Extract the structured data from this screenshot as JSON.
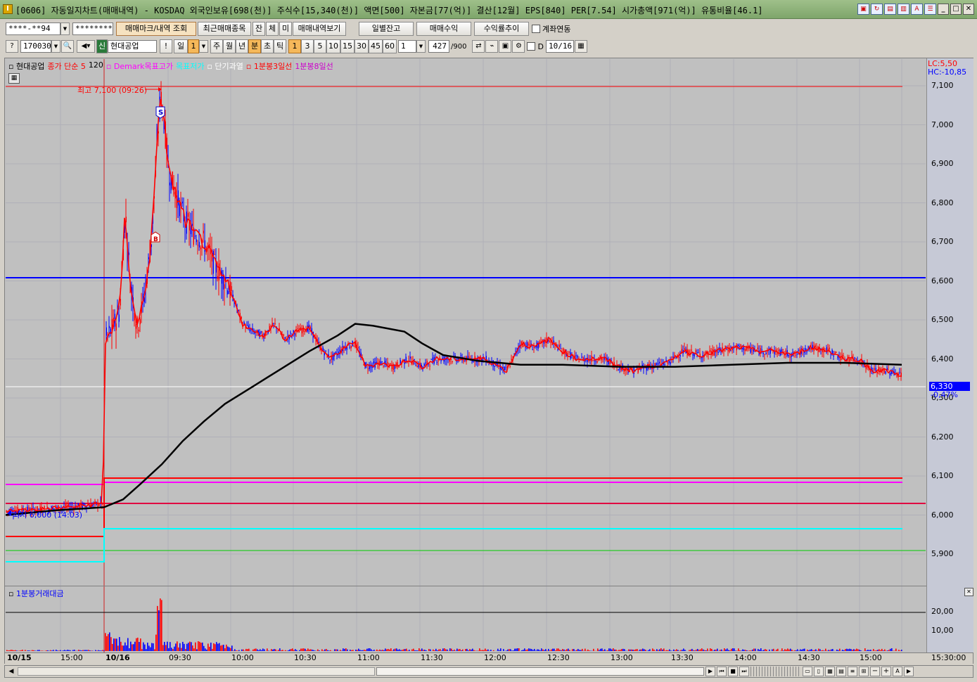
{
  "window": {
    "title": "[0606] 자동일지차트(매매내역) - KOSDAQ 외국인보유[698(천)] 주식수[15,340(천)] 액면[500] 자본금[77(억)] 결산[12월] EPS[840] PER[7.54] 시가총액[971(억)] 유통비율[46.1]",
    "icons": [
      "window-icon",
      "refresh-icon",
      "print-icon",
      "save-icon",
      "font-icon",
      "settings-icon"
    ]
  },
  "toolbar1": {
    "account": "****-**94",
    "password": "*********",
    "buttons": [
      "매매마크/내역 조회",
      "최근매매종목",
      "잔",
      "체",
      "미",
      "매매내역보기",
      "일별잔고",
      "매매수익",
      "수익률추이"
    ],
    "checkbox_label": "계좌연동"
  },
  "toolbar2": {
    "code": "170030",
    "stock_name": "현대공업",
    "new_badge": "신",
    "periods": [
      "일",
      "1",
      "주",
      "월",
      "년",
      "분",
      "초",
      "틱"
    ],
    "minutes": [
      "1",
      "3",
      "5",
      "10",
      "15",
      "30",
      "45",
      "60"
    ],
    "interval": "1",
    "count": "427",
    "count_total": "/900",
    "date_checkbox": "D",
    "date": "10/16"
  },
  "legend": [
    {
      "text": "현대공업",
      "color": "#000000"
    },
    {
      "text": "종가 단순 5",
      "color": "#ff0000"
    },
    {
      "text": "120",
      "color": "#000000"
    },
    {
      "text": "Demark목표고가",
      "color": "#ff00ff"
    },
    {
      "text": "목표저가",
      "color": "#00ffff"
    },
    {
      "text": "단기과열",
      "color": "#ffffff"
    },
    {
      "text": "1분봉3일선",
      "color": "#ff0000"
    },
    {
      "text": "1분봉8일선",
      "color": "#cc00cc"
    }
  ],
  "indicators": {
    "lc": "LC:5,50",
    "hc": "HC:-10,85"
  },
  "annotations": {
    "high": "최고 7,100 (09:26)",
    "low": "최저 6,000 (14:03)",
    "sell_mark": "S",
    "buy_mark": "B"
  },
  "price_axis": {
    "ticks": [
      "7,100",
      "7,000",
      "6,900",
      "6,800",
      "6,700",
      "6,600",
      "6,500",
      "6,400",
      "6,300",
      "6,200",
      "6,100",
      "6,000",
      "5,900"
    ],
    "current_price": "6,330",
    "current_change": "-0,47%"
  },
  "volume_panel": {
    "label": "1분봉거래대금",
    "ticks": [
      "20,00",
      "10,00"
    ]
  },
  "time_axis": {
    "labels": [
      "10/15",
      "15:00",
      "10/16",
      "09:30",
      "10:00",
      "10:30",
      "11:00",
      "11:30",
      "12:00",
      "12:30",
      "13:00",
      "13:30",
      "14:00",
      "14:30",
      "15:00",
      "15:30:00"
    ]
  },
  "colors": {
    "up": "#ff0000",
    "down": "#0000ff",
    "ma120": "#000000",
    "ma5": "#ff0000",
    "demark_high": "#ff00ff",
    "demark_low": "#00ffff",
    "hline_blue": "#0000ff",
    "hline_red": "#ff0000",
    "hline_green": "#00cc00",
    "background": "#c0c0c0"
  }
}
